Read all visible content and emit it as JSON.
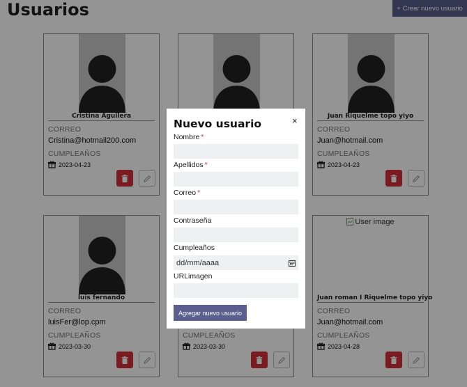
{
  "page": {
    "title": "Usuarios",
    "create_button": "Crear nuevo usuario"
  },
  "labels": {
    "email": "CORREO",
    "birthday": "CUMPLEAÑOS"
  },
  "cards": [
    {
      "name": "Cristina Aguilera",
      "email": "Cristina@hotmail200.com",
      "birthday": "2023-04-23"
    },
    {
      "name": "",
      "email": "",
      "birthday": ""
    },
    {
      "name": "Juan Riquelme topo yiyo",
      "email": "Juan@hotmail.com",
      "birthday": "2023-04-23"
    },
    {
      "name": "luis fernando",
      "email": "luisFer@lop.cpm",
      "birthday": "2023-03-30"
    },
    {
      "name": "",
      "email": "",
      "birthday": "2023-03-30"
    },
    {
      "name": "Juan roman I Riquelme topo yiyo",
      "email": "Juan@hotmail.com",
      "birthday": "2023-04-28",
      "image_alt": "User image"
    }
  ],
  "modal": {
    "title": "Nuevo usuario",
    "close": "×",
    "fields": [
      {
        "label": "Nombre",
        "required": "*",
        "value": ""
      },
      {
        "label": "Apellidos",
        "required": "*",
        "value": ""
      },
      {
        "label": "Correo",
        "required": "*",
        "value": ""
      },
      {
        "label": "Contraseña",
        "required": "",
        "value": ""
      },
      {
        "label": "Cumpleaños",
        "required": "",
        "value": "dd/mm/aaaa"
      },
      {
        "label": "URLimagen",
        "required": "",
        "value": ""
      }
    ],
    "submit": "Agregar nuevo usuario"
  },
  "colors": {
    "accent": "#5a5f8e",
    "danger": "#d32f3a",
    "avatar_bg": "#c9c9c9"
  },
  "icons": {
    "plus": "plus-icon",
    "trash": "trash-icon",
    "pencil": "pencil-icon",
    "gift": "gift-icon",
    "calendar": "calendar-icon",
    "close": "close-icon"
  }
}
